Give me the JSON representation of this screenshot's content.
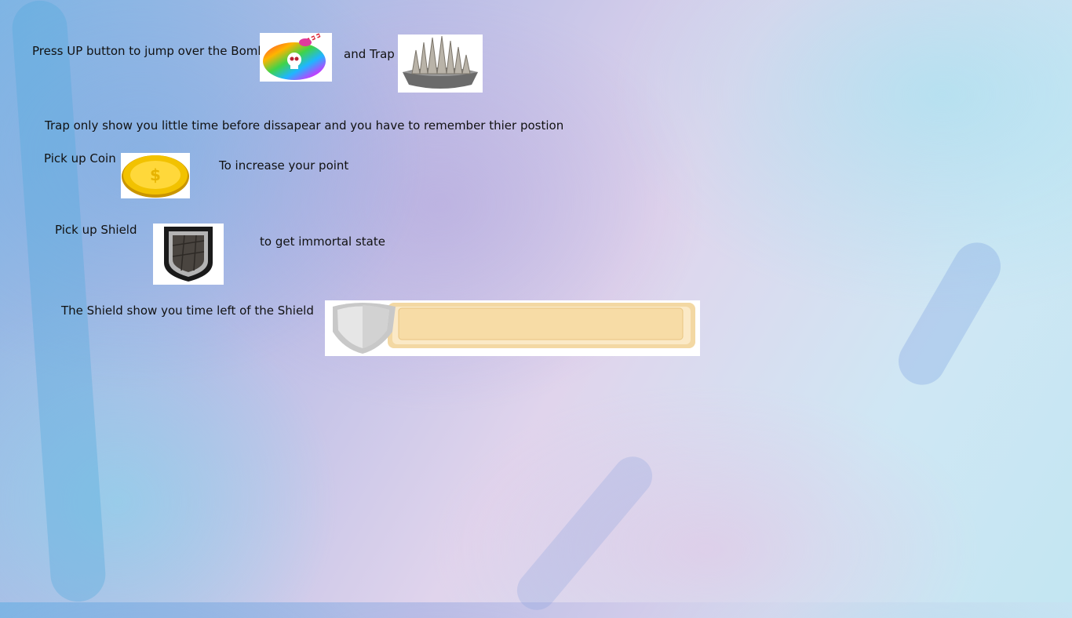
{
  "instructions": {
    "bomb_line": "Press UP button to jump over the Bomb",
    "and_trap": "and Trap",
    "trap_note": "Trap only show you little time before dissapear and you have to remember thier postion",
    "coin_pick": "Pick up Coin",
    "coin_effect": "To increase your point",
    "shield_pick": "Pick up Shield",
    "shield_effect": "to get immortal state",
    "shield_timer_note": "The Shield show you time left of the Shield"
  },
  "icons": {
    "bomb": "rainbow-bomb-icon",
    "trap": "spike-trap-icon",
    "coin": "gold-coin-icon",
    "shield": "shield-powerup-icon",
    "shield_bar": "shield-timer-bar"
  },
  "colors": {
    "text": "#111111",
    "bar_fill": "#f7dca6",
    "bar_frame": "#f3d8a3",
    "coin": "#e8b400"
  },
  "shield_timer": {
    "fill_fraction": 1.0
  }
}
